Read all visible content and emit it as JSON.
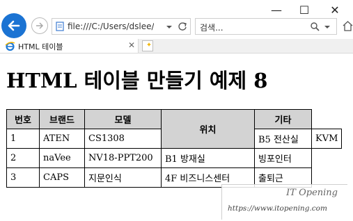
{
  "window": {
    "minimize": "—",
    "maximize": "☐",
    "close": "✕"
  },
  "address": {
    "url": "file:///C:/Users/dslee/Pictu",
    "refresh_icon": "refresh-icon"
  },
  "search": {
    "placeholder": "검색..."
  },
  "tab": {
    "title": "HTML 테이블"
  },
  "page": {
    "heading": "HTML 테이블 만들기 예제 8",
    "table": {
      "headers": [
        "번호",
        "브랜드",
        "모델",
        "위치",
        "기타"
      ],
      "rows": [
        [
          "1",
          "ATEN",
          "CS1308",
          "B5 전산실",
          "KVM"
        ],
        [
          "2",
          "naVee",
          "NV18-PPT200",
          "B1 방재실",
          "빙포인터"
        ],
        [
          "3",
          "CAPS",
          "지문인식",
          "4F 비즈니스센터",
          "출퇴근"
        ]
      ]
    }
  },
  "watermark": {
    "brand": "IT Opening",
    "url": "https://www.itopening.com"
  }
}
